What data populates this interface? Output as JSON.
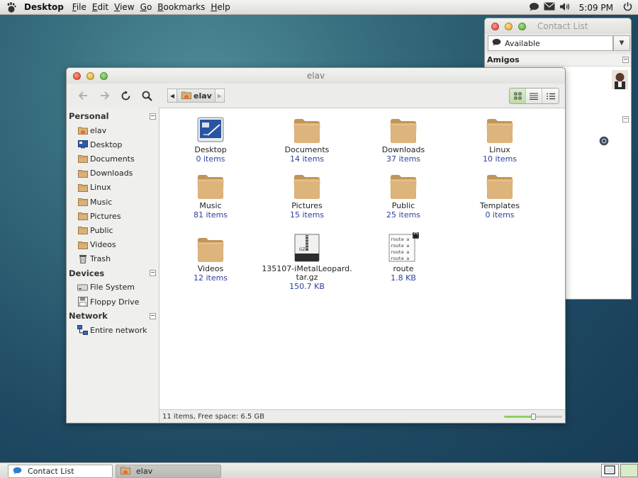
{
  "top_panel": {
    "menus": [
      {
        "label": "Desktop",
        "bold": true
      },
      {
        "label": "File",
        "u": "F",
        "rest": "ile"
      },
      {
        "label": "Edit",
        "u": "E",
        "rest": "dit"
      },
      {
        "label": "View",
        "u": "V",
        "rest": "iew"
      },
      {
        "label": "Go",
        "u": "G",
        "rest": "o"
      },
      {
        "label": "Bookmarks",
        "u": "B",
        "rest": "ookmarks"
      },
      {
        "label": "Help",
        "u": "H",
        "rest": "elp"
      }
    ],
    "tray_icons": [
      "chat-icon",
      "mail-icon",
      "volume-icon",
      "power-icon"
    ],
    "clock": "5:09 PM"
  },
  "contact_window": {
    "title": "Contact List",
    "status": "Available",
    "group": "Amigos"
  },
  "nautilus": {
    "title": "elav",
    "path_crumb": "elav",
    "sidebar": {
      "personal_header": "Personal",
      "personal": [
        {
          "label": "elav",
          "icon": "home-folder-icon"
        },
        {
          "label": "Desktop",
          "icon": "desktop-icon"
        },
        {
          "label": "Documents",
          "icon": "folder-icon"
        },
        {
          "label": "Downloads",
          "icon": "folder-icon"
        },
        {
          "label": "Linux",
          "icon": "folder-icon"
        },
        {
          "label": "Music",
          "icon": "folder-icon"
        },
        {
          "label": "Pictures",
          "icon": "folder-icon"
        },
        {
          "label": "Public",
          "icon": "folder-icon"
        },
        {
          "label": "Videos",
          "icon": "folder-icon"
        },
        {
          "label": "Trash",
          "icon": "trash-icon"
        }
      ],
      "devices_header": "Devices",
      "devices": [
        {
          "label": "File System",
          "icon": "drive-icon"
        },
        {
          "label": "Floppy Drive",
          "icon": "floppy-icon"
        }
      ],
      "network_header": "Network",
      "network": [
        {
          "label": "Entire network",
          "icon": "network-icon"
        }
      ]
    },
    "files": [
      {
        "name": "Desktop",
        "meta": "0 items",
        "kind": "desktop"
      },
      {
        "name": "Documents",
        "meta": "14 items",
        "kind": "folder"
      },
      {
        "name": "Downloads",
        "meta": "37 items",
        "kind": "folder"
      },
      {
        "name": "Linux",
        "meta": "10 items",
        "kind": "folder"
      },
      {
        "name": "Music",
        "meta": "81 items",
        "kind": "folder"
      },
      {
        "name": "Pictures",
        "meta": "15 items",
        "kind": "folder"
      },
      {
        "name": "Public",
        "meta": "25 items",
        "kind": "folder"
      },
      {
        "name": "Templates",
        "meta": "0 items",
        "kind": "folder"
      },
      {
        "name": "Videos",
        "meta": "12 items",
        "kind": "folder"
      },
      {
        "name": "135107-iMetalLeopard.\ntar.gz",
        "meta": "150.7 KB",
        "kind": "archive",
        "badge": "GZ"
      },
      {
        "name": "route",
        "meta": "1.8 KB",
        "kind": "text",
        "preview": "route a"
      }
    ],
    "status_text": "11 items, Free space: 6.5 GB",
    "zoom_level": 0.5
  },
  "bottom_panel": {
    "tasks": [
      {
        "label": "Contact List",
        "icon": "chat-icon",
        "active": false
      },
      {
        "label": "elav",
        "icon": "home-folder-icon",
        "active": true
      }
    ]
  },
  "colors": {
    "folder": "#d9b27a",
    "meta_text": "#2c3f9e",
    "desktop_bg": "#2a5670"
  }
}
